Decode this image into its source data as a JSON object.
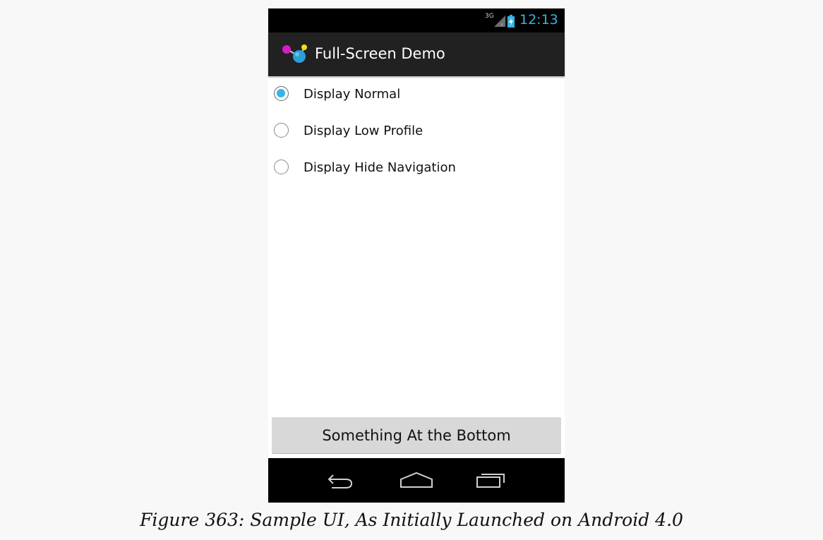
{
  "status_bar": {
    "network_type": "3G",
    "time": "12:13",
    "signal_icon": "signal-icon",
    "battery_icon": "battery-charging-icon"
  },
  "action_bar": {
    "app_icon": "app-launcher-icon",
    "title": "Full-Screen Demo"
  },
  "radio_options": [
    {
      "label": "Display Normal",
      "checked": true
    },
    {
      "label": "Display Low Profile",
      "checked": false
    },
    {
      "label": "Display Hide Navigation",
      "checked": false
    }
  ],
  "bottom_button": {
    "label": "Something At the Bottom"
  },
  "nav_bar": {
    "back_icon": "back-icon",
    "home_icon": "home-icon",
    "recents_icon": "recent-apps-icon"
  },
  "caption": "Figure 363: Sample UI, As Initially Launched on Android 4.0",
  "colors": {
    "accent": "#33b5e5",
    "action_bar": "#212121",
    "status_bar": "#000000",
    "button": "#d8d8d8"
  }
}
